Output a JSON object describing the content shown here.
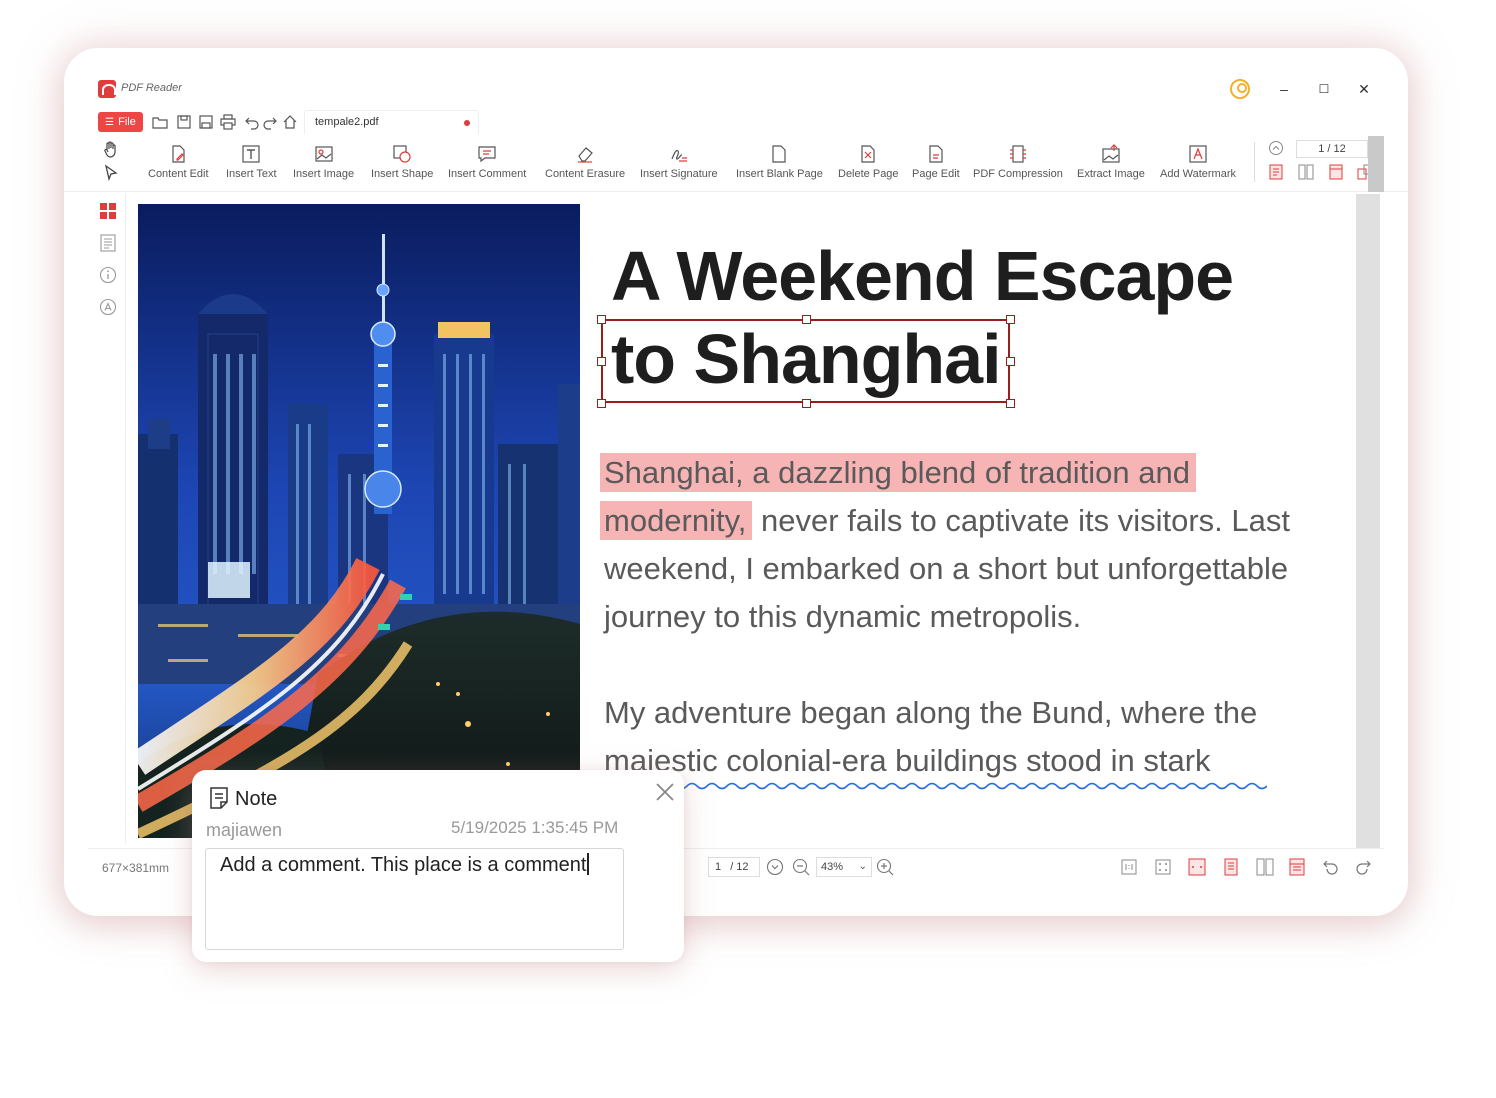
{
  "app": {
    "name": "PDF Reader"
  },
  "window_controls": {
    "minimize": "–",
    "maximize": "☐",
    "close": "✕"
  },
  "quickbar": {
    "file_label": "File",
    "file_tab": "tempale2.pdf"
  },
  "ribbon": {
    "tools": [
      {
        "label": "Content Edit",
        "icon": "content-edit-icon"
      },
      {
        "label": "Insert Text",
        "icon": "insert-text-icon"
      },
      {
        "label": "Insert Image",
        "icon": "insert-image-icon"
      },
      {
        "label": "Insert Shape",
        "icon": "insert-shape-icon"
      },
      {
        "label": "Insert Comment",
        "icon": "insert-comment-icon"
      },
      {
        "label": "Content Erasure",
        "icon": "eraser-icon"
      },
      {
        "label": "Insert Signature",
        "icon": "signature-icon"
      },
      {
        "label": "Insert Blank Page",
        "icon": "blank-page-icon"
      },
      {
        "label": "Delete Page",
        "icon": "delete-page-icon"
      },
      {
        "label": "Page Edit",
        "icon": "page-edit-icon"
      },
      {
        "label": "PDF Compression",
        "icon": "compression-icon"
      },
      {
        "label": "Extract Image",
        "icon": "extract-image-icon"
      },
      {
        "label": "Add Watermark",
        "icon": "watermark-icon"
      }
    ],
    "page_indicator": "1 / 12"
  },
  "document": {
    "title_line1": "A Weekend Escape",
    "title_line2": "to Shanghai",
    "para1": {
      "highlight_a": "Shanghai, a dazzling blend of tradition and",
      "highlight_b": "modernity,",
      "rest_b": " never fails to captivate its visitors. Last",
      "line3": "weekend, I embarked on a short but unforgettable",
      "line4": "journey to this dynamic metropolis."
    },
    "para2": {
      "line1": "My adventure began along the Bund, where the",
      "line2": "majestic colonial-era buildings stood in stark"
    }
  },
  "statusbar": {
    "dimensions": "677×381mm",
    "page_current": "1",
    "page_total": "/ 12",
    "zoom": "43%"
  },
  "note": {
    "title": "Note",
    "author": "majiawen",
    "timestamp": "5/19/2025 1:35:45 PM",
    "comment": "Add a comment. This place is a comment"
  },
  "colors": {
    "accent": "#e23b3b",
    "highlight": "#f6b4b4",
    "selection": "#9c1d1d",
    "underline": "#2a6fd6"
  }
}
